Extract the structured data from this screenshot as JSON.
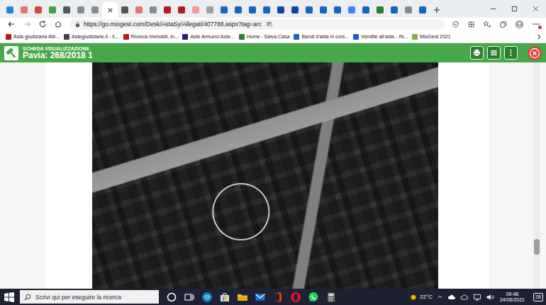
{
  "browser": {
    "tabs": [
      {
        "selected": false,
        "color": "#1e88e5"
      },
      {
        "selected": false,
        "color": "#e57373"
      },
      {
        "selected": false,
        "color": "#d44638"
      },
      {
        "selected": false,
        "color": "#43a047"
      },
      {
        "selected": false,
        "color": "#555555"
      },
      {
        "selected": false,
        "color": "#8a8a8a"
      },
      {
        "selected": false,
        "color": "#8a8a8a"
      },
      {
        "selected": true
      },
      {
        "selected": false,
        "color": "#555555"
      },
      {
        "selected": false,
        "color": "#e57373"
      },
      {
        "selected": false,
        "color": "#8a8a8a"
      },
      {
        "selected": false,
        "color": "#b71c1c"
      },
      {
        "selected": false,
        "color": "#b71c1c"
      },
      {
        "selected": false,
        "color": "#ef9a9a"
      },
      {
        "selected": false,
        "color": "#9e9e9e"
      },
      {
        "selected": false,
        "color": "#1565c0"
      },
      {
        "selected": false,
        "color": "#1565c0"
      },
      {
        "selected": false,
        "color": "#1565c0"
      },
      {
        "selected": false,
        "color": "#1565c0"
      },
      {
        "selected": false,
        "color": "#0d47a1"
      },
      {
        "selected": false,
        "color": "#0d47a1"
      },
      {
        "selected": false,
        "color": "#1565c0"
      },
      {
        "selected": false,
        "color": "#1565c0"
      },
      {
        "selected": false,
        "color": "#1565c0"
      },
      {
        "selected": false,
        "color": "#4285f4"
      },
      {
        "selected": false,
        "color": "#1565c0"
      },
      {
        "selected": false,
        "color": "#2e7d32"
      },
      {
        "selected": false,
        "color": "#1565c0"
      },
      {
        "selected": false,
        "color": "#8a8a8a"
      },
      {
        "selected": false,
        "color": "#1565c0"
      }
    ],
    "url": "https://go.miogest.com/Desk/AstaSy/Allegati/407788.aspx?tag=arc",
    "menu_alert": true,
    "bookmarks": [
      {
        "label": "Asta giudiziaria Abi...",
        "color": "#b71c1c"
      },
      {
        "label": "Astegiudiziarie.it - Il...",
        "color": "#444444"
      },
      {
        "label": "Ricerca Immobili, in...",
        "color": "#b71c1c"
      },
      {
        "label": "Aste Annunci Aste...",
        "color": "#1a237e"
      },
      {
        "label": "Home - Salva Casa",
        "color": "#2e7d32"
      },
      {
        "label": "Bandi d'asta in cors...",
        "color": "#1565c0"
      },
      {
        "label": "Vendite all'asta - IN...",
        "color": "#1565c0"
      },
      {
        "label": "MioGest 2021",
        "color": "#7cb342"
      }
    ]
  },
  "header": {
    "subtitle": "SCHEDA VISUALIZZAZIONE",
    "title": "Pavia: 268/2018 1"
  },
  "scrollbar": {
    "level": 0.84
  },
  "taskbar": {
    "search_placeholder": "Scrivi qui per eseguire la ricerca",
    "weather": "22°C",
    "time": "09:48",
    "date": "24/06/2021",
    "notifications": "28"
  }
}
